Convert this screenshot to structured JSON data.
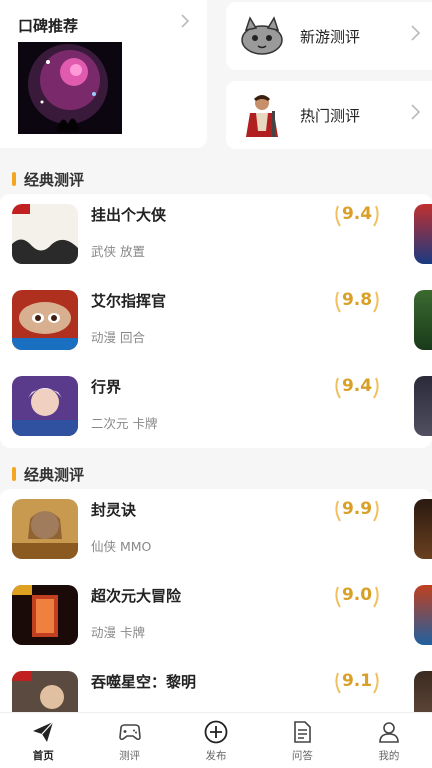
{
  "header": {
    "koubei_title": "口碑推荐",
    "cards": [
      {
        "label": "新游测评",
        "icon": "cat-mascot-icon"
      },
      {
        "label": "热门测评",
        "icon": "hero-character-icon"
      }
    ]
  },
  "sections": [
    {
      "title": "经典测评",
      "games": [
        {
          "name": "挂出个大侠",
          "tags": "武侠 放置",
          "score": "9.4"
        },
        {
          "name": "艾尔指挥官",
          "tags": "动漫 回合",
          "score": "9.8"
        },
        {
          "name": "行界",
          "tags": "二次元 卡牌",
          "score": "9.4"
        }
      ]
    },
    {
      "title": "经典测评",
      "games": [
        {
          "name": "封灵诀",
          "tags": "仙侠 MMO",
          "score": "9.9"
        },
        {
          "name": "超次元大冒险",
          "tags": "动漫 卡牌",
          "score": "9.0"
        },
        {
          "name": "吞噬星空：黎明",
          "tags": "",
          "score": "9.1"
        }
      ]
    }
  ],
  "nav": {
    "items": [
      {
        "label": "首页",
        "icon": "paper-plane-icon",
        "active": true
      },
      {
        "label": "测评",
        "icon": "gamepad-icon",
        "active": false
      },
      {
        "label": "发布",
        "icon": "plus-circle-icon",
        "active": false
      },
      {
        "label": "问答",
        "icon": "document-icon",
        "active": false
      },
      {
        "label": "我的",
        "icon": "user-icon",
        "active": false
      }
    ]
  },
  "colors": {
    "accent": "#f4a623",
    "score": "#d9a027"
  }
}
